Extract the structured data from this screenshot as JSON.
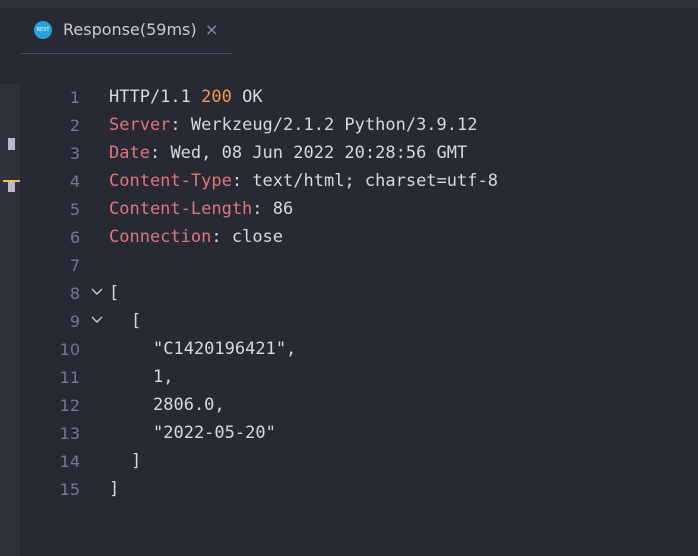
{
  "tab": {
    "icon_text": "REST",
    "title": "Response(59ms)",
    "close_glyph": "×"
  },
  "response": {
    "status": {
      "version": "HTTP/1.1",
      "code": "200",
      "text": "OK"
    },
    "headers": [
      {
        "name": "Server",
        "value": "Werkzeug/2.1.2 Python/3.9.12"
      },
      {
        "name": "Date",
        "value": "Wed, 08 Jun 2022 20:28:56 GMT"
      },
      {
        "name": "Content-Type",
        "value": "text/html; charset=utf-8"
      },
      {
        "name": "Content-Length",
        "value": "86"
      },
      {
        "name": "Connection",
        "value": "close"
      }
    ],
    "body_lines": [
      "[",
      "[",
      "\"C1420196421\",",
      "1,",
      "2806.0,",
      "\"2022-05-20\"",
      "]",
      "]"
    ]
  },
  "line_numbers": [
    "1",
    "2",
    "3",
    "4",
    "5",
    "6",
    "7",
    "8",
    "9",
    "10",
    "11",
    "12",
    "13",
    "14",
    "15"
  ],
  "colors": {
    "background": "#272935",
    "header_name": "#e0767a",
    "status_code": "#f29a4b",
    "text": "#d6d8e2",
    "line_number": "#777a8a",
    "tab_icon": "#28a3d9"
  }
}
